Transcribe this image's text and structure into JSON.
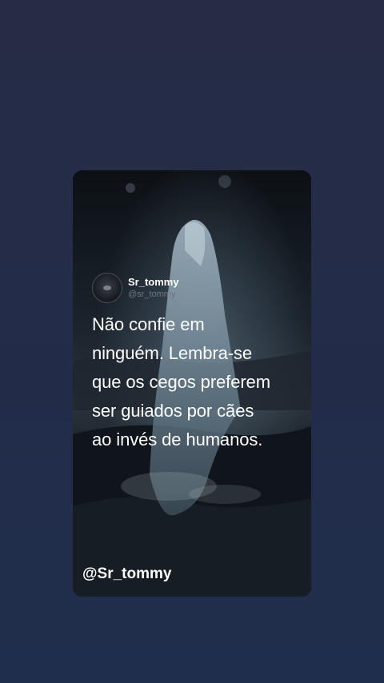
{
  "post": {
    "display_name": "Sr_tommy",
    "handle": "@sr_tommy",
    "avatar_icon": "avatar-icon",
    "quote_lines": [
      "Não confie em",
      "ninguém. Lembra-se",
      "que os cegos preferem",
      "ser guiados por cães",
      "ao invés de humanos."
    ]
  },
  "watermark": "@Sr_tommy",
  "colors": {
    "background": "#232c48",
    "text": "#ffffff",
    "handle": "#6f7780"
  }
}
